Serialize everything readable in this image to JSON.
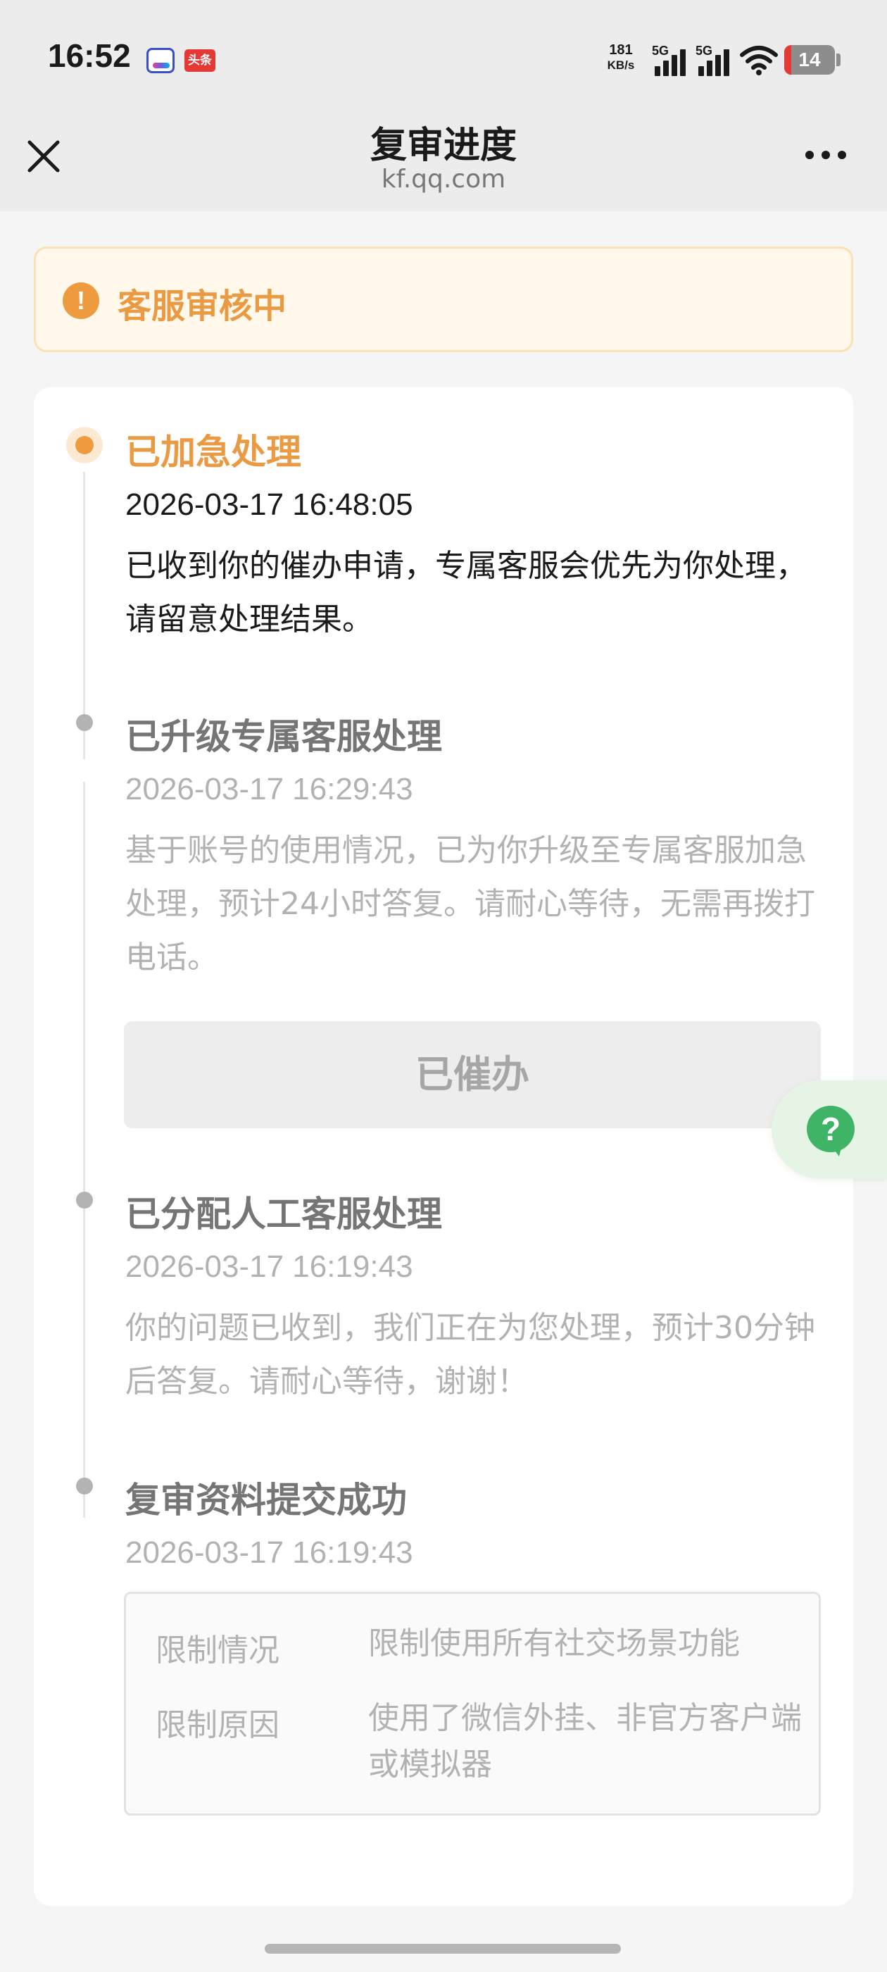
{
  "status_bar": {
    "time": "16:52",
    "app_icon_2_text": "头条",
    "net_speed_value": "181",
    "net_speed_unit": "KB/s",
    "signal_1_tag": "5G",
    "signal_2_tag": "5G",
    "battery_level": "14",
    "battery_fill_fraction": 0.14,
    "battery_color": "#e53935"
  },
  "nav": {
    "title": "复审进度",
    "subtitle": "kf.qq.com",
    "close_icon": "close-icon",
    "more_icon": "more-dots-icon"
  },
  "banner": {
    "icon": "!",
    "text": "客服审核中",
    "accent_color": "#e99a43"
  },
  "timeline": {
    "steps": [
      {
        "title": "已加急处理",
        "time": "2026-03-17 16:48:05",
        "desc": "已收到你的催办申请，专属客服会优先为你处理，请留意处理结果。",
        "active": true
      },
      {
        "title": "已升级专属客服处理",
        "time": "2026-03-17 16:29:43",
        "desc": "基于账号的使用情况，已为你升级至专属客服加急处理，预计24小时答复。请耐心等待，无需再拨打电话。",
        "button_label": "已催办"
      },
      {
        "title": "已分配人工客服处理",
        "time": "2026-03-17 16:19:43",
        "desc": "你的问题已收到，我们正在为您处理，预计30分钟后答复。请耐心等待，谢谢！"
      },
      {
        "title": "复审资料提交成功",
        "time": "2026-03-17 16:19:43",
        "info": [
          {
            "label": "限制情况",
            "value": "限制使用所有社交场景功能"
          },
          {
            "label": "限制原因",
            "value": "使用了微信外挂、非官方客户端或模拟器"
          }
        ]
      }
    ]
  },
  "help_float": {
    "icon": "?",
    "color": "#3fb466"
  }
}
